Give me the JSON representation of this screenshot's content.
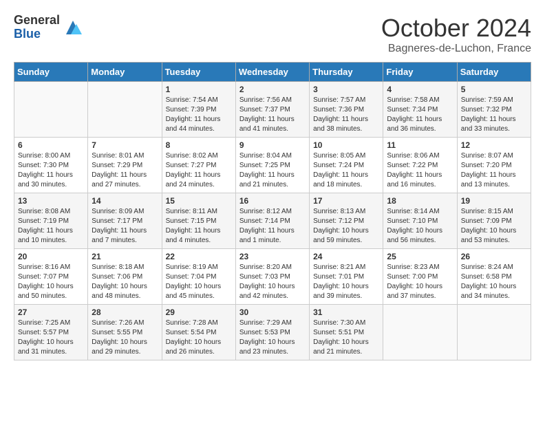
{
  "header": {
    "logo_general": "General",
    "logo_blue": "Blue",
    "month_title": "October 2024",
    "subtitle": "Bagneres-de-Luchon, France"
  },
  "days_of_week": [
    "Sunday",
    "Monday",
    "Tuesday",
    "Wednesday",
    "Thursday",
    "Friday",
    "Saturday"
  ],
  "weeks": [
    [
      {
        "day": "",
        "info": ""
      },
      {
        "day": "",
        "info": ""
      },
      {
        "day": "1",
        "info": "Sunrise: 7:54 AM\nSunset: 7:39 PM\nDaylight: 11 hours and 44 minutes."
      },
      {
        "day": "2",
        "info": "Sunrise: 7:56 AM\nSunset: 7:37 PM\nDaylight: 11 hours and 41 minutes."
      },
      {
        "day": "3",
        "info": "Sunrise: 7:57 AM\nSunset: 7:36 PM\nDaylight: 11 hours and 38 minutes."
      },
      {
        "day": "4",
        "info": "Sunrise: 7:58 AM\nSunset: 7:34 PM\nDaylight: 11 hours and 36 minutes."
      },
      {
        "day": "5",
        "info": "Sunrise: 7:59 AM\nSunset: 7:32 PM\nDaylight: 11 hours and 33 minutes."
      }
    ],
    [
      {
        "day": "6",
        "info": "Sunrise: 8:00 AM\nSunset: 7:30 PM\nDaylight: 11 hours and 30 minutes."
      },
      {
        "day": "7",
        "info": "Sunrise: 8:01 AM\nSunset: 7:29 PM\nDaylight: 11 hours and 27 minutes."
      },
      {
        "day": "8",
        "info": "Sunrise: 8:02 AM\nSunset: 7:27 PM\nDaylight: 11 hours and 24 minutes."
      },
      {
        "day": "9",
        "info": "Sunrise: 8:04 AM\nSunset: 7:25 PM\nDaylight: 11 hours and 21 minutes."
      },
      {
        "day": "10",
        "info": "Sunrise: 8:05 AM\nSunset: 7:24 PM\nDaylight: 11 hours and 18 minutes."
      },
      {
        "day": "11",
        "info": "Sunrise: 8:06 AM\nSunset: 7:22 PM\nDaylight: 11 hours and 16 minutes."
      },
      {
        "day": "12",
        "info": "Sunrise: 8:07 AM\nSunset: 7:20 PM\nDaylight: 11 hours and 13 minutes."
      }
    ],
    [
      {
        "day": "13",
        "info": "Sunrise: 8:08 AM\nSunset: 7:19 PM\nDaylight: 11 hours and 10 minutes."
      },
      {
        "day": "14",
        "info": "Sunrise: 8:09 AM\nSunset: 7:17 PM\nDaylight: 11 hours and 7 minutes."
      },
      {
        "day": "15",
        "info": "Sunrise: 8:11 AM\nSunset: 7:15 PM\nDaylight: 11 hours and 4 minutes."
      },
      {
        "day": "16",
        "info": "Sunrise: 8:12 AM\nSunset: 7:14 PM\nDaylight: 11 hours and 1 minute."
      },
      {
        "day": "17",
        "info": "Sunrise: 8:13 AM\nSunset: 7:12 PM\nDaylight: 10 hours and 59 minutes."
      },
      {
        "day": "18",
        "info": "Sunrise: 8:14 AM\nSunset: 7:10 PM\nDaylight: 10 hours and 56 minutes."
      },
      {
        "day": "19",
        "info": "Sunrise: 8:15 AM\nSunset: 7:09 PM\nDaylight: 10 hours and 53 minutes."
      }
    ],
    [
      {
        "day": "20",
        "info": "Sunrise: 8:16 AM\nSunset: 7:07 PM\nDaylight: 10 hours and 50 minutes."
      },
      {
        "day": "21",
        "info": "Sunrise: 8:18 AM\nSunset: 7:06 PM\nDaylight: 10 hours and 48 minutes."
      },
      {
        "day": "22",
        "info": "Sunrise: 8:19 AM\nSunset: 7:04 PM\nDaylight: 10 hours and 45 minutes."
      },
      {
        "day": "23",
        "info": "Sunrise: 8:20 AM\nSunset: 7:03 PM\nDaylight: 10 hours and 42 minutes."
      },
      {
        "day": "24",
        "info": "Sunrise: 8:21 AM\nSunset: 7:01 PM\nDaylight: 10 hours and 39 minutes."
      },
      {
        "day": "25",
        "info": "Sunrise: 8:23 AM\nSunset: 7:00 PM\nDaylight: 10 hours and 37 minutes."
      },
      {
        "day": "26",
        "info": "Sunrise: 8:24 AM\nSunset: 6:58 PM\nDaylight: 10 hours and 34 minutes."
      }
    ],
    [
      {
        "day": "27",
        "info": "Sunrise: 7:25 AM\nSunset: 5:57 PM\nDaylight: 10 hours and 31 minutes."
      },
      {
        "day": "28",
        "info": "Sunrise: 7:26 AM\nSunset: 5:55 PM\nDaylight: 10 hours and 29 minutes."
      },
      {
        "day": "29",
        "info": "Sunrise: 7:28 AM\nSunset: 5:54 PM\nDaylight: 10 hours and 26 minutes."
      },
      {
        "day": "30",
        "info": "Sunrise: 7:29 AM\nSunset: 5:53 PM\nDaylight: 10 hours and 23 minutes."
      },
      {
        "day": "31",
        "info": "Sunrise: 7:30 AM\nSunset: 5:51 PM\nDaylight: 10 hours and 21 minutes."
      },
      {
        "day": "",
        "info": ""
      },
      {
        "day": "",
        "info": ""
      }
    ]
  ]
}
